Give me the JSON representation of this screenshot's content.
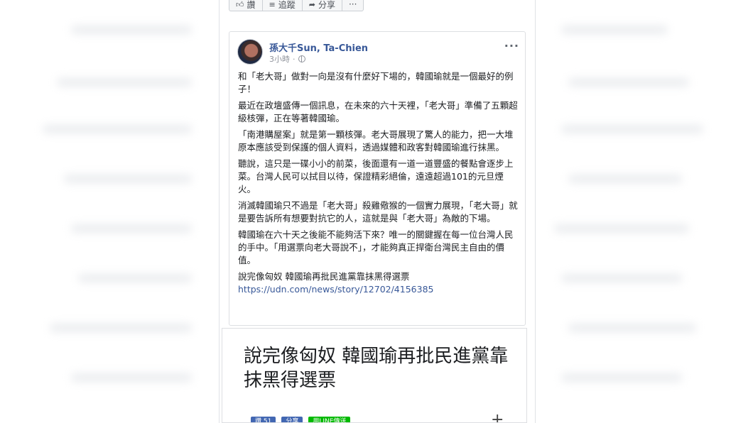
{
  "action_bar": {
    "like_label": "讚",
    "follow_label": "追蹤",
    "share_label": "分享",
    "more_label": "···"
  },
  "post": {
    "author": "孫大千Sun, Ta-Chien",
    "time": "3小時",
    "paragraphs": [
      "和「老大哥」做對一向是沒有什麼好下場的，韓國瑜就是一個最好的例子！",
      "最近在政壇盛傳一個訊息，在未來的六十天裡，「老大哥」準備了五顆超級核彈，正在等著韓國瑜。",
      "「南港購屋案」就是第一顆核彈。老大哥展現了驚人的能力，把一大堆原本應該受到保護的個人資料，透過媒體和政客對韓國瑜進行抹黑。",
      "聽說，這只是一碟小小的前菜，後面還有一道一道豐盛的餐點會逐步上菜。台灣人民可以拭目以待，保證精彩絕倫，遠遠超過101的元旦煙火。",
      "消滅韓國瑜只不過是「老大哥」殺雞儆猴的一個實力展現，「老大哥」就是要告訴所有想要對抗它的人，這就是與「老大哥」為敵的下場。",
      "韓國瑜在六十天之後能不能夠活下來？唯一的關鍵握在每一位台灣人民的手中。「用選票向老大哥說不」，才能夠真正捍衛台灣民主自由的價值。"
    ],
    "link_title": "說完像匈奴 韓國瑜再批民進黨靠抹黑得選票",
    "link_url": "https://udn.com/news/story/12702/4156385"
  },
  "preview": {
    "headline": "說完像匈奴 韓國瑜再批民進黨靠抹黑得選票",
    "like_label": "讚 51",
    "share_label": "分享",
    "line_label": "用LINE傳送",
    "plus_label": "+"
  },
  "colors": {
    "link": "#385898",
    "facebook_blue": "#4267b2",
    "line_green": "#00b900"
  }
}
